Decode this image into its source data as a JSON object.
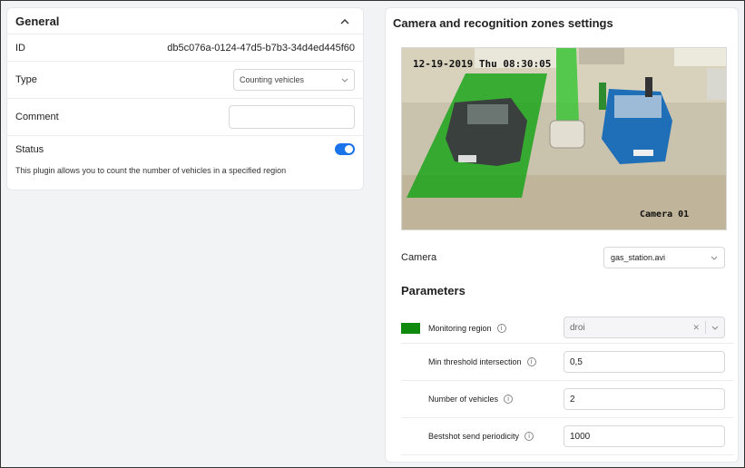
{
  "general": {
    "title": "General",
    "id_label": "ID",
    "id_value": "db5c076a-0124-47d5-b7b3-34d4ed445f60",
    "type_label": "Type",
    "type_value": "Counting vehicles",
    "comment_label": "Comment",
    "comment_value": "",
    "status_label": "Status",
    "status_on": true,
    "description": "This plugin allows you to count the number of vehicles in a specified region"
  },
  "right": {
    "title": "Camera and recognition zones settings",
    "camera_timestamp": "12-19-2019 Thu 08:30:05",
    "camera_overlay": "Camera 01",
    "camera_label": "Camera",
    "camera_value": "gas_station.avi",
    "parameters_title": "Parameters",
    "params": {
      "monitoring_region_label": "Monitoring region",
      "monitoring_region_value": "droi",
      "min_threshold_label": "Min threshold intersection",
      "min_threshold_value": "0,5",
      "num_vehicles_label": "Number of vehicles",
      "num_vehicles_value": "2",
      "bestshot_label": "Bestshot send periodicity",
      "bestshot_value": "1000"
    }
  },
  "colors": {
    "accent": "#1a73e8",
    "zone_green": "#0f8a0f"
  }
}
